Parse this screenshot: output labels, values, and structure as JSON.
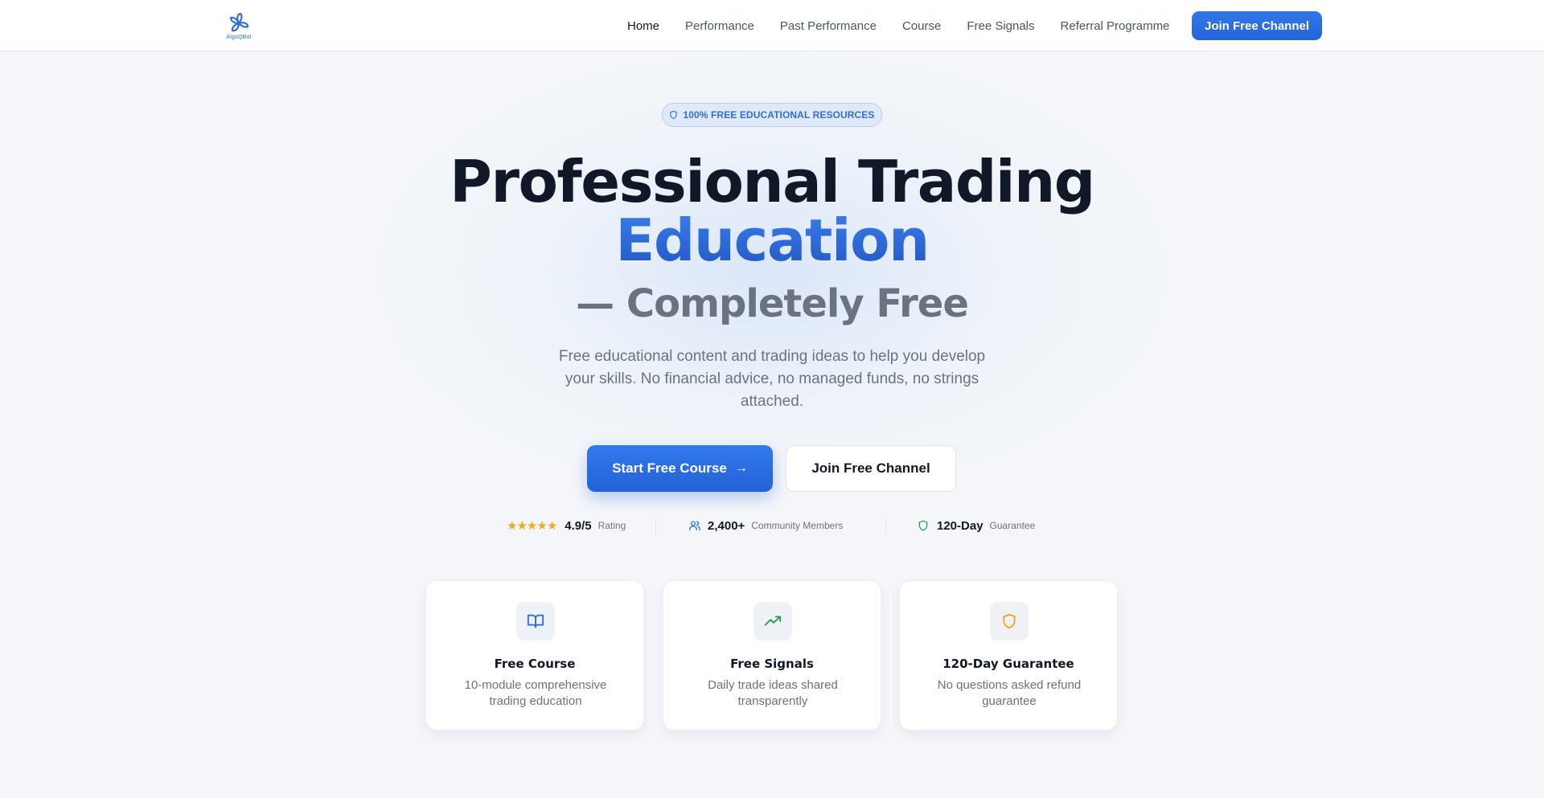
{
  "brand": {
    "logo_text": "AlgoQBot",
    "accent_color": "#2a6ae0"
  },
  "nav": {
    "links": [
      {
        "label": "Home",
        "active": true
      },
      {
        "label": "Performance",
        "active": false
      },
      {
        "label": "Past Performance",
        "active": false
      },
      {
        "label": "Course",
        "active": false
      },
      {
        "label": "Free Signals",
        "active": false
      },
      {
        "label": "Referral Programme",
        "active": false
      }
    ],
    "cta_label": "Join Free Channel"
  },
  "hero": {
    "badge": "100% FREE EDUCATIONAL RESOURCES",
    "title_line1": "Professional Trading",
    "title_line2": "Education",
    "title_line3": "— Completely Free",
    "subtitle": "Free educational content and trading ideas to help you develop your skills. No financial advice, no managed funds, no strings attached.",
    "primary_button": "Start Free Course",
    "secondary_button": "Join Free Channel"
  },
  "stats": {
    "rating": {
      "value": "4.9/5",
      "label": "Rating",
      "stars": 5
    },
    "members": {
      "value": "2,400+",
      "label": "Community Members"
    },
    "guarantee": {
      "value": "120-Day",
      "label": "Guarantee"
    }
  },
  "features": [
    {
      "icon": "book-open-icon",
      "title": "Free Course",
      "description": "10-module comprehensive trading education",
      "icon_color": "#2f6fd8"
    },
    {
      "icon": "trending-up-icon",
      "title": "Free Signals",
      "description": "Daily trade ideas shared transparently",
      "icon_color": "#16a34a"
    },
    {
      "icon": "shield-icon",
      "title": "120-Day Guarantee",
      "description": "No questions asked refund guarantee",
      "icon_color": "#f59e0b"
    }
  ]
}
